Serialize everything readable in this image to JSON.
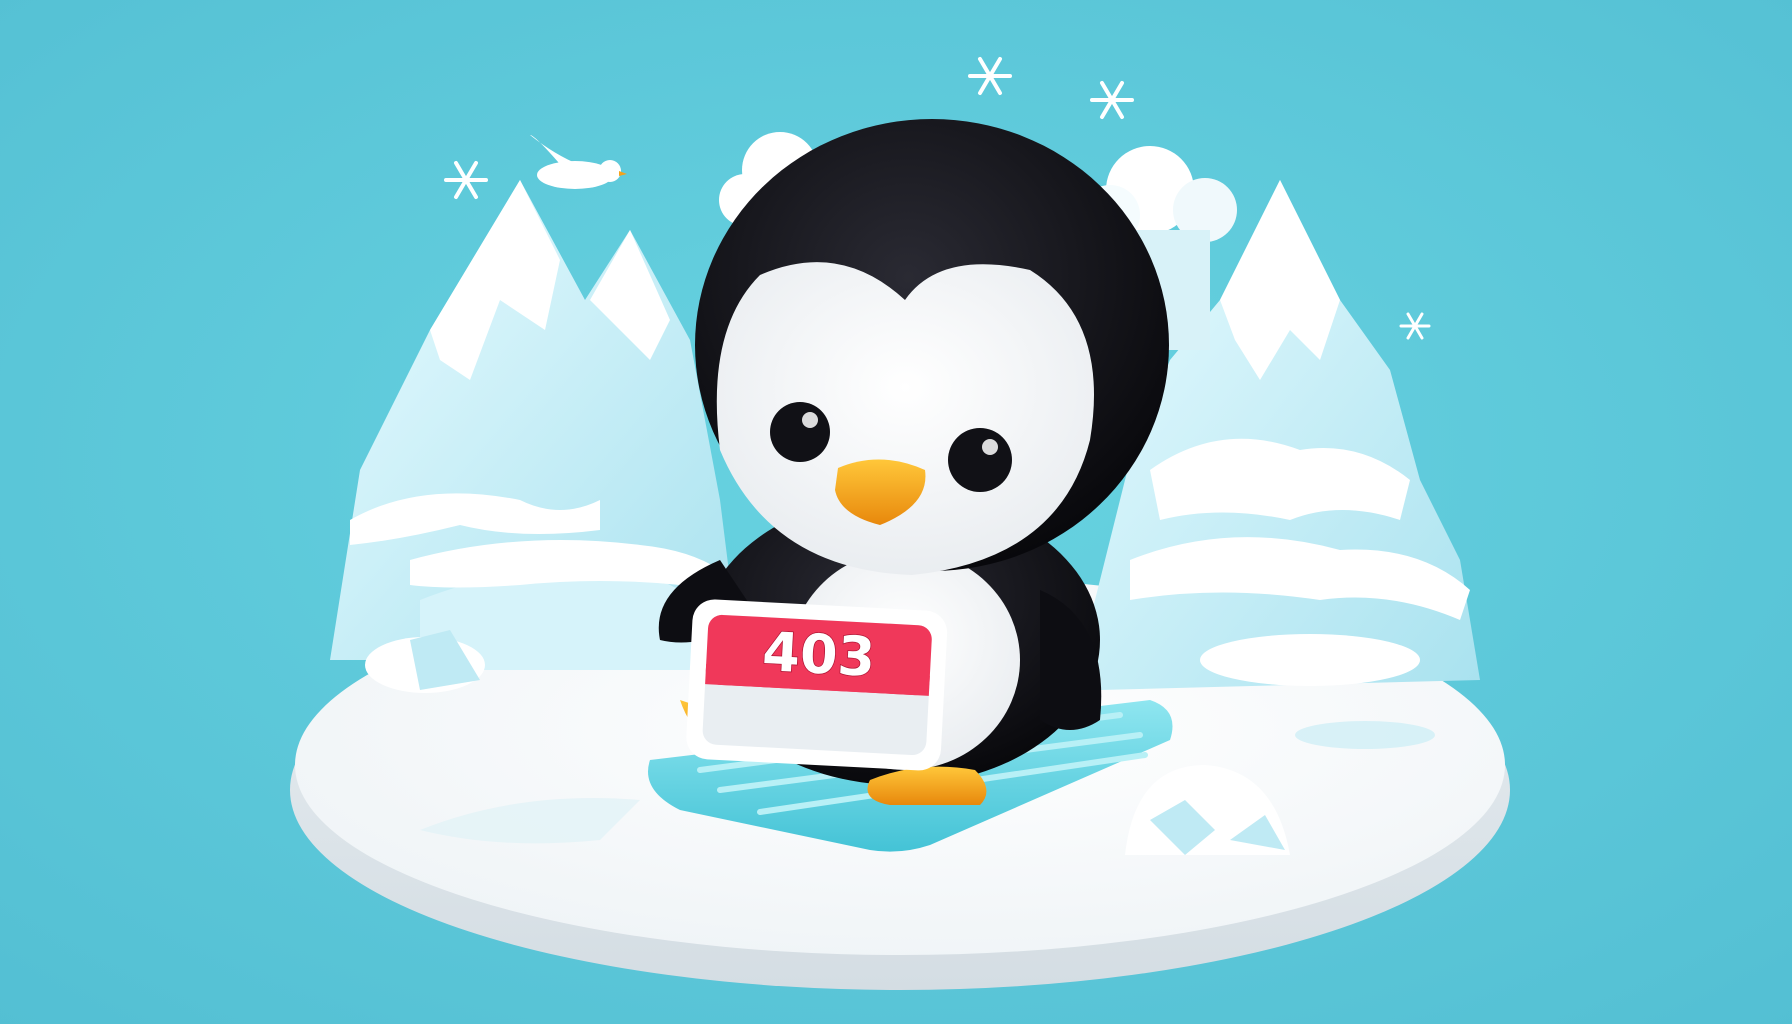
{
  "sign": {
    "text": "403"
  },
  "colors": {
    "background_top": "#5cc6d6",
    "background_bottom": "#6fe1ee",
    "snow": "#ffffff",
    "ice": "#bfeaf4",
    "penguin_body": "#0b0b10",
    "penguin_belly": "#ffffff",
    "beak": "#f5a21a",
    "sign_band": "#f0385a",
    "sign_panel": "#e9eef2",
    "sled": "#68d6e6"
  },
  "icons": {
    "character": "penguin-icon",
    "bird": "bird-icon",
    "snowflake": "snowflake-icon"
  }
}
